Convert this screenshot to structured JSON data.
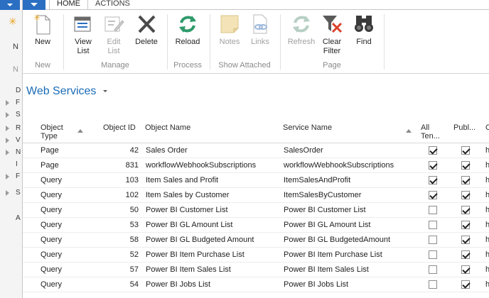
{
  "background_window": {
    "text_n": "N",
    "text_n2": "N",
    "letters": [
      "D",
      "F",
      "S",
      "R",
      "V",
      "N",
      "I",
      "F",
      "S",
      "A"
    ]
  },
  "ribbon": {
    "tabs": [
      {
        "label": "HOME"
      },
      {
        "label": "ACTIONS"
      }
    ],
    "buttons": {
      "new": "New",
      "view_list": "View\nList",
      "edit_list": "Edit\nList",
      "delete": "Delete",
      "reload": "Reload",
      "notes": "Notes",
      "links": "Links",
      "refresh": "Refresh",
      "clear_filter": "Clear\nFilter",
      "find": "Find"
    },
    "groups": {
      "new": "New",
      "manage": "Manage",
      "process": "Process",
      "show_attached": "Show Attached",
      "page": "Page"
    }
  },
  "page": {
    "title": "Web Services"
  },
  "grid": {
    "columns": {
      "object_type": "Object\nType",
      "object_id": "Object ID",
      "object_name": "Object Name",
      "service_name": "Service Name",
      "all_tenants": "All\nTen...",
      "published": "Publ..."
    },
    "rows": [
      {
        "type": "Page",
        "id": "42",
        "name": "Sales Order",
        "service": "SalesOrder",
        "all": true,
        "pub": true
      },
      {
        "type": "Page",
        "id": "831",
        "name": "workflowWebhookSubscriptions",
        "service": "workflowWebhookSubscriptions",
        "all": true,
        "pub": true
      },
      {
        "type": "Query",
        "id": "103",
        "name": "Item Sales and Profit",
        "service": "ItemSalesAndProfit",
        "all": true,
        "pub": true
      },
      {
        "type": "Query",
        "id": "102",
        "name": "Item Sales by Customer",
        "service": "ItemSalesByCustomer",
        "all": true,
        "pub": true
      },
      {
        "type": "Query",
        "id": "50",
        "name": "Power BI Customer List",
        "service": "Power BI Customer List",
        "all": false,
        "pub": true
      },
      {
        "type": "Query",
        "id": "53",
        "name": "Power BI GL Amount List",
        "service": "Power BI GL Amount List",
        "all": false,
        "pub": true
      },
      {
        "type": "Query",
        "id": "58",
        "name": "Power BI GL Budgeted Amount",
        "service": "Power BI GL BudgetedAmount",
        "all": false,
        "pub": true
      },
      {
        "type": "Query",
        "id": "52",
        "name": "Power BI Item Purchase List",
        "service": "Power BI Item Purchase List",
        "all": false,
        "pub": true
      },
      {
        "type": "Query",
        "id": "57",
        "name": "Power BI Item Sales List",
        "service": "Power BI Item Sales List",
        "all": false,
        "pub": true
      },
      {
        "type": "Query",
        "id": "54",
        "name": "Power BI Jobs List",
        "service": "Power BI Jobs List",
        "all": false,
        "pub": true
      }
    ]
  }
}
